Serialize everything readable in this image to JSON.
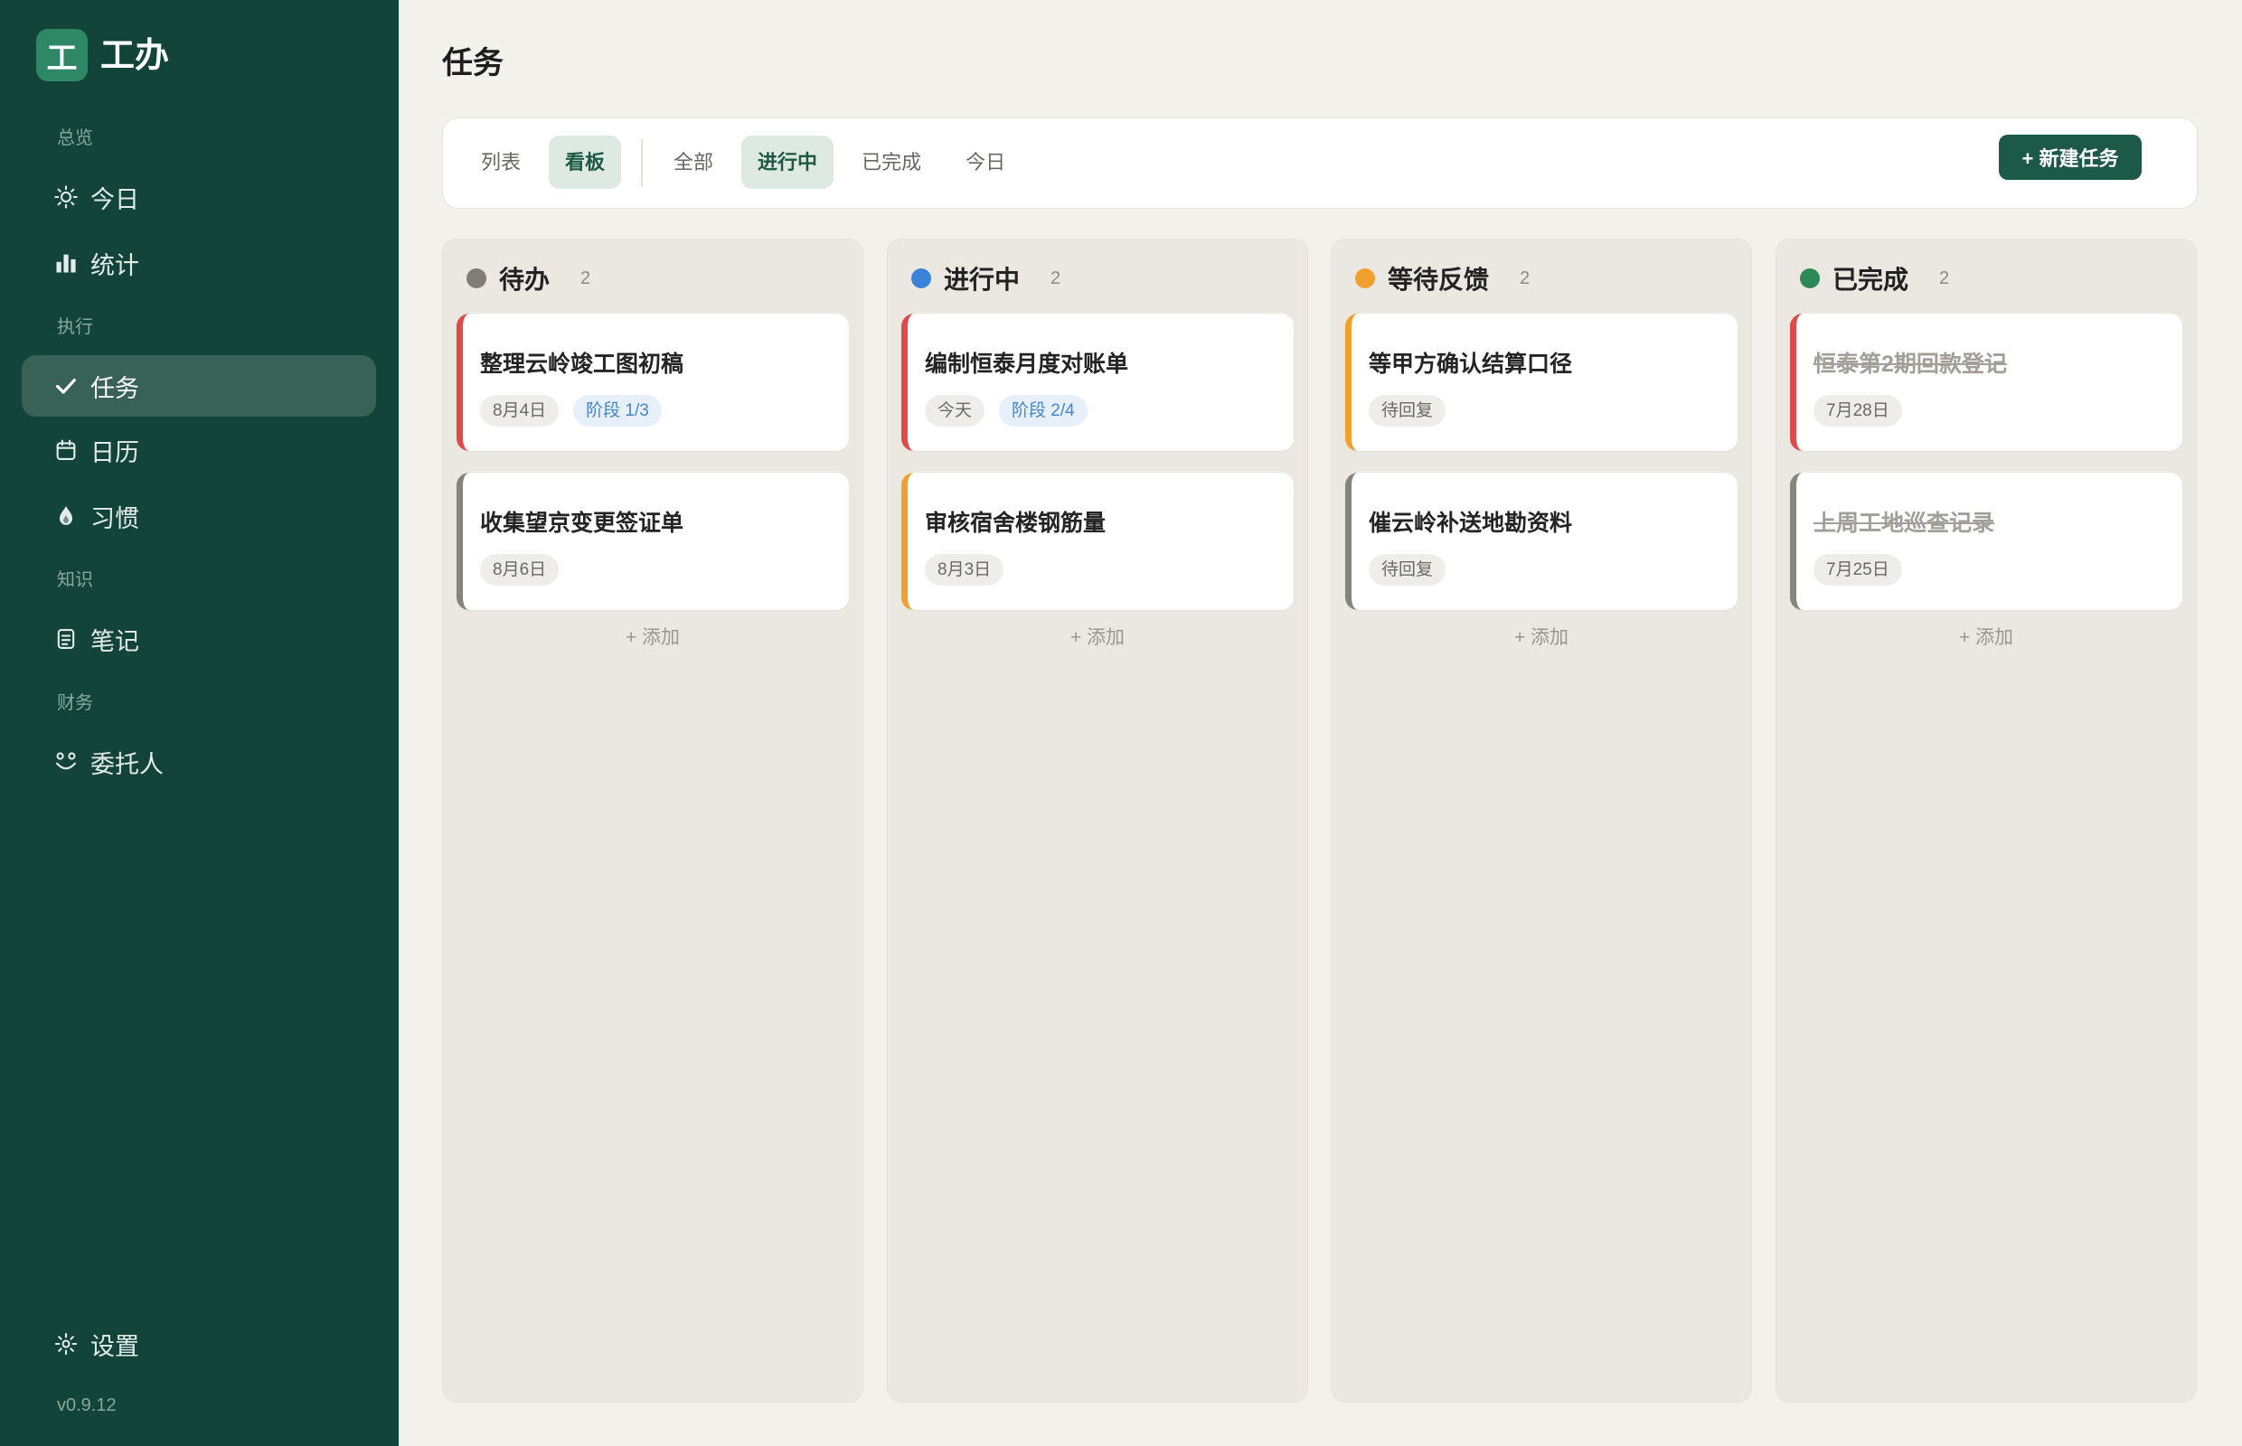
{
  "brand": {
    "logo_char": "工",
    "name": "工办"
  },
  "sidebar": {
    "groups": [
      {
        "label": "总览",
        "items": [
          {
            "label": "今日",
            "icon": "sun-icon"
          },
          {
            "label": "统计",
            "icon": "bar-chart-icon"
          }
        ]
      },
      {
        "label": "执行",
        "items": [
          {
            "label": "任务",
            "icon": "check-icon",
            "active": true
          },
          {
            "label": "日历",
            "icon": "calendar-icon"
          },
          {
            "label": "习惯",
            "icon": "flame-icon"
          }
        ]
      },
      {
        "label": "知识",
        "items": [
          {
            "label": "笔记",
            "icon": "note-icon"
          }
        ]
      },
      {
        "label": "财务",
        "items": [
          {
            "label": "委托人",
            "icon": "clients-icon"
          }
        ]
      }
    ],
    "settings": {
      "label": "设置",
      "icon": "gear-icon"
    },
    "version": "v0.9.12"
  },
  "page": {
    "title": "任务"
  },
  "toolbar": {
    "view_tabs": [
      {
        "label": "列表",
        "active": false
      },
      {
        "label": "看板",
        "active": true
      }
    ],
    "filter_tabs": [
      {
        "label": "全部",
        "active": false
      },
      {
        "label": "进行中",
        "active": true
      },
      {
        "label": "已完成",
        "active": false
      },
      {
        "label": "今日",
        "active": false
      }
    ],
    "new_task_label": "+ 新建任务"
  },
  "board": {
    "add_label": "+ 添加",
    "columns": [
      {
        "title": "待办",
        "count": "2",
        "color": "#7f7d78",
        "cards": [
          {
            "title": "整理云岭竣工图初稿",
            "accent": "#e04a4a",
            "done": false,
            "tags": [
              {
                "text": "8月4日",
                "kind": "date"
              },
              {
                "text": "阶段 1/3",
                "kind": "stage"
              }
            ]
          },
          {
            "title": "收集望京变更签证单",
            "accent": "#87847e",
            "done": false,
            "tags": [
              {
                "text": "8月6日",
                "kind": "date"
              }
            ]
          }
        ]
      },
      {
        "title": "进行中",
        "count": "2",
        "color": "#3a83d8",
        "cards": [
          {
            "title": "编制恒泰月度对账单",
            "accent": "#e04a4a",
            "done": false,
            "tags": [
              {
                "text": "今天",
                "kind": "date"
              },
              {
                "text": "阶段 2/4",
                "kind": "stage"
              }
            ]
          },
          {
            "title": "审核宿舍楼钢筋量",
            "accent": "#f0a12d",
            "done": false,
            "tags": [
              {
                "text": "8月3日",
                "kind": "date"
              }
            ]
          }
        ]
      },
      {
        "title": "等待反馈",
        "count": "2",
        "color": "#f0a12d",
        "cards": [
          {
            "title": "等甲方确认结算口径",
            "accent": "#f0a12d",
            "done": false,
            "tags": [
              {
                "text": "待回复",
                "kind": "status"
              }
            ]
          },
          {
            "title": "催云岭补送地勘资料",
            "accent": "#87847e",
            "done": false,
            "tags": [
              {
                "text": "待回复",
                "kind": "status"
              }
            ]
          }
        ]
      },
      {
        "title": "已完成",
        "count": "2",
        "color": "#2d8a58",
        "cards": [
          {
            "title": "恒泰第2期回款登记",
            "accent": "#e04a4a",
            "done": true,
            "tags": [
              {
                "text": "7月28日",
                "kind": "date"
              }
            ]
          },
          {
            "title": "上周工地巡查记录",
            "accent": "#87847e",
            "done": true,
            "tags": [
              {
                "text": "7月25日",
                "kind": "date"
              }
            ]
          }
        ]
      }
    ]
  },
  "colors": {
    "sidebar_bg": "#13443a",
    "primary": "#1c5a47",
    "main_bg": "#f3f1ec"
  }
}
